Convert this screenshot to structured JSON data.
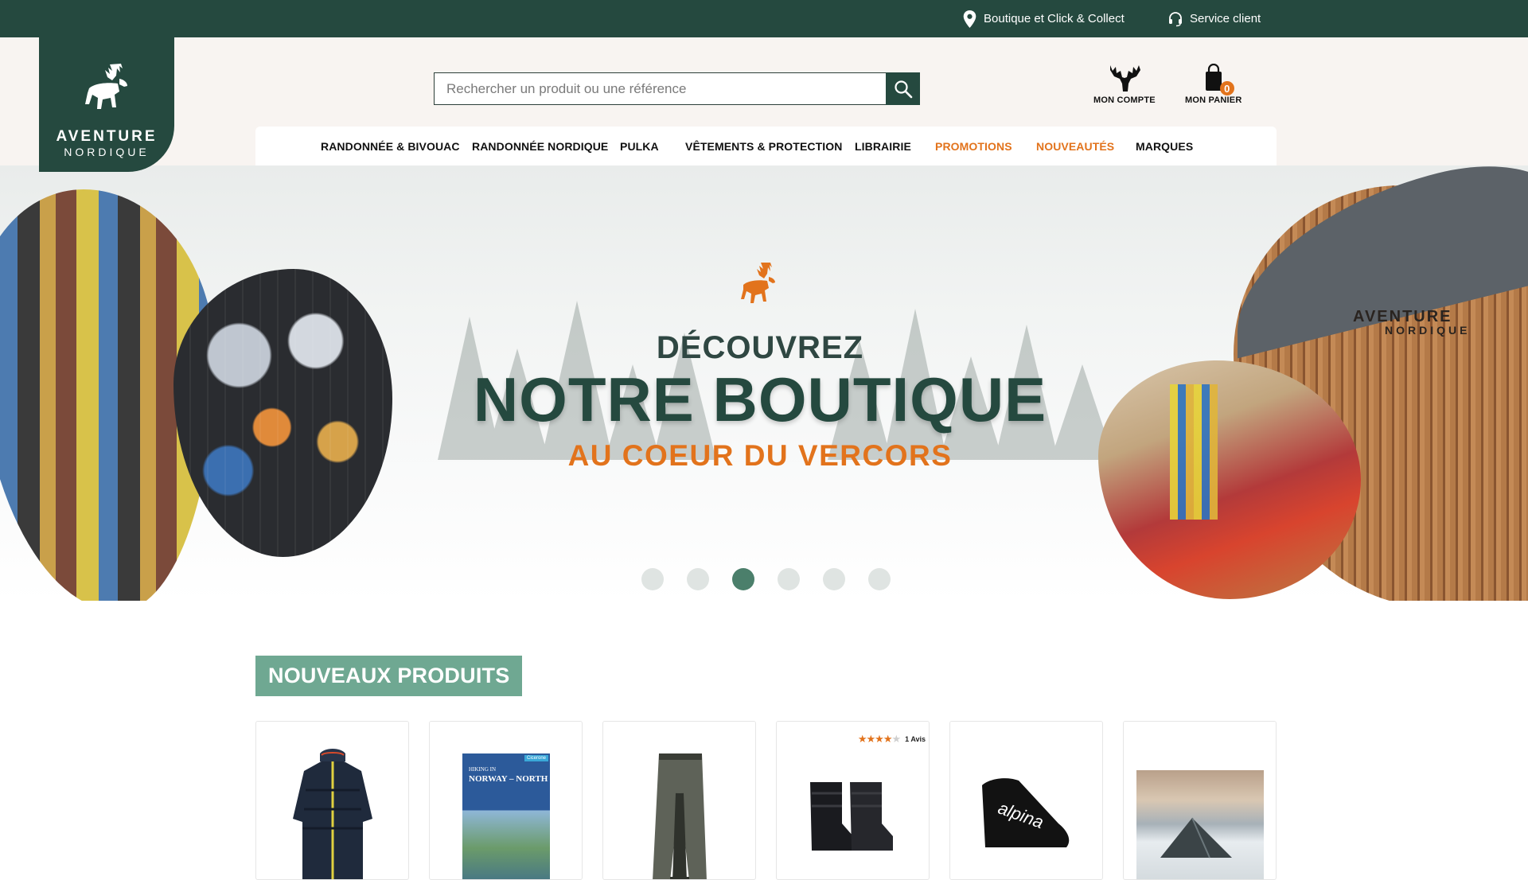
{
  "topbar": {
    "store": "Boutique et Click & Collect",
    "service": "Service client"
  },
  "logo": {
    "line1": "AVENTURE",
    "line2": "NORDIQUE"
  },
  "search": {
    "placeholder": "Rechercher un produit ou une référence",
    "value": ""
  },
  "header": {
    "account": "MON COMPTE",
    "cart": "MON PANIER",
    "cart_count": "0"
  },
  "nav": [
    {
      "label": "RANDONNÉE & BIVOUAC"
    },
    {
      "label": "RANDONNÉE NORDIQUE"
    },
    {
      "label": "PULKA"
    },
    {
      "label": "VÊTEMENTS & PROTECTION"
    },
    {
      "label": "LIBRAIRIE"
    },
    {
      "label": "PROMOTIONS"
    },
    {
      "label": "NOUVEAUTÉS"
    },
    {
      "label": "MARQUES"
    }
  ],
  "hero": {
    "pre": "DÉCOUVREZ",
    "main": "NOTRE BOUTIQUE",
    "sub": "AU COEUR DU VERCORS",
    "chalet_sign1": "AVENTURE",
    "chalet_sign2": "NORDIQUE",
    "slide_count": 6,
    "active_slide": 3
  },
  "products": {
    "title": "NOUVEAUX PRODUITS",
    "book_title": "NORWAY – NORTH",
    "book_pre": "HIKING IN",
    "book_badge": "Cicerone",
    "review_count": "1 Avis",
    "rating": 4,
    "rating_max": 5
  },
  "colors": {
    "brand_green": "#25493f",
    "accent_orange": "#e2731c",
    "section_green": "#6fa892",
    "header_bg": "#f8f4f1"
  }
}
